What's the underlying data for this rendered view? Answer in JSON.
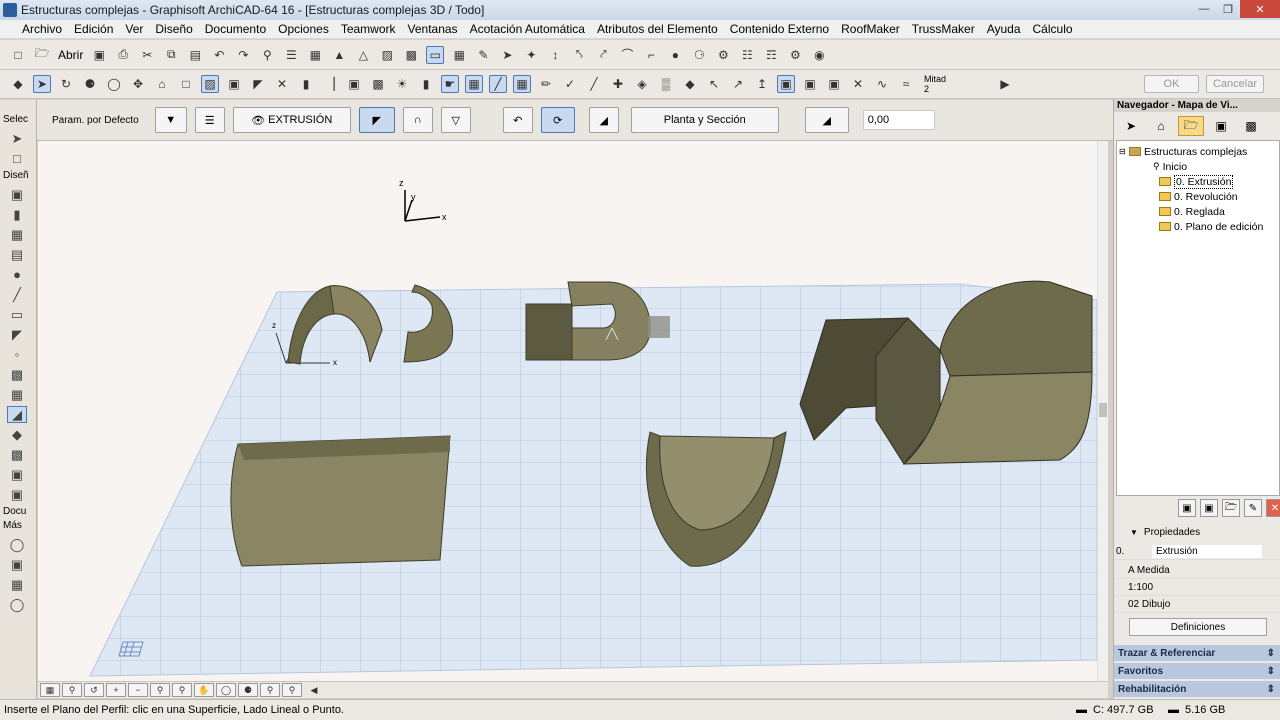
{
  "window": {
    "title": "Estructuras complejas - Graphisoft ArchiCAD-64 16 - [Estructuras complejas 3D / Todo]"
  },
  "menu": [
    "Archivo",
    "Edición",
    "Ver",
    "Diseño",
    "Documento",
    "Opciones",
    "Teamwork",
    "Ventanas",
    "Acotación Automática",
    "Atributos del Elemento",
    "Contenido Externo",
    "RoofMaker",
    "TrussMaker",
    "Ayuda",
    "Cálculo"
  ],
  "toolbar": {
    "open_label": "Abrir",
    "mitad_label": "Mitad",
    "mitad_value": "2",
    "ok_label": "OK",
    "cancel_label": "Cancelar"
  },
  "infobox": {
    "param_label": "Param. por Defecto",
    "extrusion_label": "EXTRUSIÓN",
    "plan_section_label": "Planta y Sección",
    "value_field": "0,00"
  },
  "toolbox": {
    "select_label": "Selec",
    "design_label": "Diseñ",
    "docu_label": "Docu",
    "more_label": "Más"
  },
  "viewport": {
    "axis_z": "z",
    "axis_y": "y",
    "axis_x": "x"
  },
  "navigator": {
    "title": "Navegador - Mapa de Vi...",
    "tree": {
      "root": "Estructuras complejas",
      "items": [
        "Inicio",
        "0. Extrusión",
        "0. Revolución",
        "0. Reglada",
        "0. Plano de edición"
      ],
      "selected_index": 1
    },
    "properties": {
      "title": "Propiedades",
      "id_value": "0.",
      "name_value": "Extrusión",
      "rows": [
        "A Medida",
        "1:100",
        "02 Dibujo"
      ],
      "definitions_button": "Definiciones"
    },
    "sections": [
      "Trazar & Referenciar",
      "Favoritos",
      "Rehabilitación"
    ]
  },
  "statusbar": {
    "prompt": "Inserte el Plano del Perfil: clic en una Superficie, Lado Lineal o Punto.",
    "disk_c": "C: 497.7 GB",
    "memory": "5.16 GB"
  }
}
